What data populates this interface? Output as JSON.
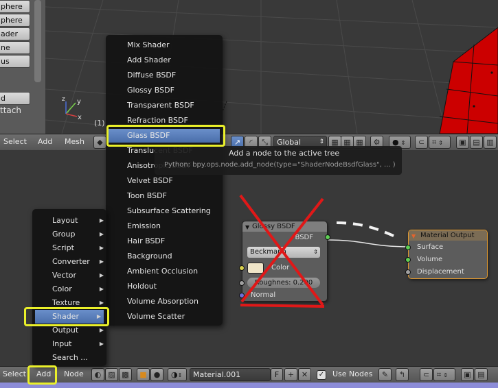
{
  "viewport": {
    "object_list": [
      "phere",
      "phere",
      "ader",
      "ne",
      "us"
    ],
    "object_extra": "d",
    "attach_label": "ttach",
    "frame_label": "(1)",
    "axis_y": "y",
    "axis_x": "x",
    "axis_z": "z"
  },
  "view3d_header": {
    "select": "Select",
    "add": "Add",
    "mesh": "Mesh",
    "orientation": "Global"
  },
  "shader_menu": {
    "items": [
      "Mix Shader",
      "Add Shader",
      "Diffuse BSDF",
      "Glossy BSDF",
      "Transparent BSDF",
      "Refraction BSDF",
      "Glass BSDF",
      "Translucent BSDF",
      "Anisotropic BSDF",
      "Velvet BSDF",
      "Toon BSDF",
      "Subsurface Scattering",
      "Emission",
      "Hair BSDF",
      "Background",
      "Ambient Occlusion",
      "Holdout",
      "Volume Absorption",
      "Volume Scatter"
    ],
    "selected_index": 6
  },
  "tooltip": {
    "title": "Add a node to the active tree",
    "python": "Python: bpy.ops.node.add_node(type=\"ShaderNodeBsdfGlass\", ... )"
  },
  "add_menu": {
    "items": [
      {
        "label": "Layout",
        "arrow": "▶"
      },
      {
        "label": "Group",
        "arrow": "▶"
      },
      {
        "label": "Script",
        "arrow": "▶"
      },
      {
        "label": "Converter",
        "arrow": "▶"
      },
      {
        "label": "Vector",
        "arrow": "▶"
      },
      {
        "label": "Color",
        "arrow": "▶"
      },
      {
        "label": "Texture",
        "arrow": "▶"
      },
      {
        "label": "Shader",
        "arrow": "▶"
      },
      {
        "label": "Output",
        "arrow": "▶"
      },
      {
        "label": "Input",
        "arrow": "▶"
      },
      {
        "label": "Search ...",
        "arrow": ""
      }
    ],
    "selected_index": 7
  },
  "glossy_node": {
    "title": "Glossy BSDF",
    "output": "BSDF",
    "distribution": "Beckmann",
    "color_label": "Color",
    "roughness": "Roughnes: 0.200",
    "normal_label": "Normal",
    "color_swatch": "#efe5c8"
  },
  "output_node": {
    "title": "Material Output",
    "inputs": [
      "Surface",
      "Volume",
      "Displacement"
    ]
  },
  "node_header": {
    "select": "Select",
    "add": "Add",
    "node": "Node",
    "material": "Material.001",
    "fake_user": "F",
    "use_nodes": "Use Nodes"
  },
  "colors": {
    "highlight": "#eaf02a",
    "menu_selected": "#5a7fbc",
    "cross": "#e01818",
    "mesh_red": "#cc0000"
  }
}
